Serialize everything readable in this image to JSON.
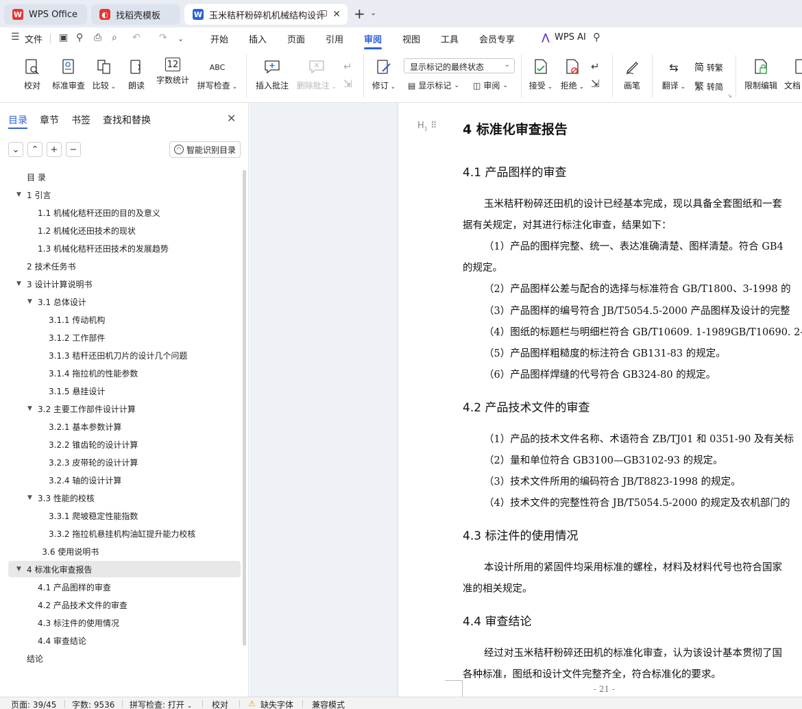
{
  "tabs": [
    {
      "label": "WPS Office",
      "icon": "wps-logo-icon",
      "color": "#e8362f"
    },
    {
      "label": "找稻壳模板",
      "icon": "docer-logo-icon",
      "color": "#e8362f"
    },
    {
      "label": "玉米秸秆粉碎机机械结构设计",
      "icon": "writer-doc-icon",
      "color": "#2b62d9"
    }
  ],
  "menu": {
    "file": "文件",
    "items": [
      "开始",
      "插入",
      "页面",
      "引用",
      "审阅",
      "视图",
      "工具",
      "会员专享"
    ],
    "active": "审阅",
    "wps_ai": "WPS AI"
  },
  "ribbon": {
    "proofread": "校对",
    "standard_review": "标准审查",
    "compare": "比较",
    "read_aloud": "朗读",
    "word_count": "字数统计",
    "spell_check": "拼写检查",
    "insert_comment": "插入批注",
    "delete_comment": "删除批注",
    "revise": "修订",
    "markup_select": "显示标记的最终状态",
    "show_markup": "显示标记",
    "review": "审阅",
    "accept": "接受",
    "reject": "拒绝",
    "pen": "画笔",
    "translate": "翻译",
    "to_traditional": "转繁",
    "to_simplified": "转简",
    "restrict_edit": "限制编辑",
    "doc_partial": "文档"
  },
  "nav": {
    "tabs": [
      "目录",
      "章节",
      "书签",
      "查找和替换"
    ],
    "active_tab": "目录",
    "smart_toc": "智能识别目录",
    "toc": [
      {
        "text": "目  录",
        "level": 0,
        "caret": false
      },
      {
        "text": "1 引言",
        "level": 0,
        "caret": true
      },
      {
        "text": "1.1 机械化秸秆还田的目的及意义",
        "level": 1,
        "caret": false
      },
      {
        "text": "1.2 机械化还田技术的现状",
        "level": 1,
        "caret": false
      },
      {
        "text": "1.3 机械化秸秆还田技术的发展趋势",
        "level": 1,
        "caret": false
      },
      {
        "text": "2 技术任务书",
        "level": 0,
        "caret": false
      },
      {
        "text": "3 设计计算说明书",
        "level": 0,
        "caret": true
      },
      {
        "text": "3.1 总体设计",
        "level": 1,
        "caret": true
      },
      {
        "text": "3.1.1 传动机构",
        "level": 2,
        "caret": false
      },
      {
        "text": "3.1.2 工作部件",
        "level": 2,
        "caret": false
      },
      {
        "text": "3.1.3 秸秆还田机刀片的设计几个问题",
        "level": 2,
        "caret": false
      },
      {
        "text": "3.1.4 拖拉机的性能参数",
        "level": 2,
        "caret": false
      },
      {
        "text": "3.1.5 悬挂设计",
        "level": 2,
        "caret": false
      },
      {
        "text": "3.2 主要工作部件设计计算",
        "level": 1,
        "caret": true
      },
      {
        "text": "3.2.1 基本参数计算",
        "level": 2,
        "caret": false
      },
      {
        "text": "3.2.2 锥齿轮的设计计算",
        "level": 2,
        "caret": false
      },
      {
        "text": "3.2.3 皮带轮的设计计算",
        "level": 2,
        "caret": false
      },
      {
        "text": "3.2.4 轴的设计计算",
        "level": 2,
        "caret": false
      },
      {
        "text": "3.3 性能的校核",
        "level": 1,
        "caret": true
      },
      {
        "text": "3.3.1 爬坡稳定性能指数",
        "level": 2,
        "caret": false
      },
      {
        "text": "3.3.2 拖拉机悬挂机构油缸提升能力校核",
        "level": 2,
        "caret": false
      },
      {
        "text": "3.6 使用说明书",
        "level": 1.4,
        "caret": false
      },
      {
        "text": "4 标准化审查报告",
        "level": 0,
        "caret": true,
        "selected": true
      },
      {
        "text": "4.1 产品图样的审查",
        "level": 1,
        "caret": false
      },
      {
        "text": "4.2 产品技术文件的审查",
        "level": 1,
        "caret": false
      },
      {
        "text": "4.3 标注件的使用情况",
        "level": 1,
        "caret": false
      },
      {
        "text": "4.4 审查结论",
        "level": 1,
        "caret": false
      },
      {
        "text": "结论",
        "level": 0,
        "caret": false
      }
    ]
  },
  "document": {
    "h1": "4   标准化审查报告",
    "s41": "4.1 产品图样的审查",
    "p41a": "玉米秸秆粉碎还田机的设计已经基本完成，现以具备全套图纸和一套",
    "p41b": "据有关规定，对其进行标注化审查，结果如下：",
    "p41c1": "（1）产品的图样完整、统一、表达准确清楚、图样清楚。符合 GB4",
    "p41c2": "的规定。",
    "p41d": "（2）产品图样公差与配合的选择与标准符合 GB/T1800、3-1998 的",
    "p41e": "（3）产品图样的编号符合 JB/T5054.5-2000 产品图样及设计的完整",
    "p41f": "（4）图纸的标题栏与明细栏符合 GB/T10609. 1-1989GB/T10690. 2-",
    "p41g": "（5）产品图样粗糙度的标注符合 GB131-83 的规定。",
    "p41h": "（6）产品图样焊缝的代号符合 GB324-80 的规定。",
    "s42": "4.2 产品技术文件的审查",
    "p42a": "（1）产品的技术文件名称、术语符合 ZB/TJ01 和 0351-90 及有关标",
    "p42b": "（2）量和单位符合 GB3100—GB3102-93 的规定。",
    "p42c": "（3）技术文件所用的编码符合 JB/T8823-1998 的规定。",
    "p42d": "（4）技术文件的完整性符合 JB/T5054.5-2000 的规定及农机部门的",
    "s43": "4.3 标注件的使用情况",
    "p43a": "本设计所用的紧固件均采用标准的螺栓，材料及材料代号也符合国家",
    "p43b": "准的相关规定。",
    "s44": "4.4 审查结论",
    "p44a": "经过对玉米秸秆粉碎还田机的标准化审查，认为该设计基本贯彻了国",
    "p44b": "各种标准，图纸和设计文件完整齐全，符合标准化的要求。",
    "page_number": "- 21 -"
  },
  "status": {
    "page": "页面: 39/45",
    "words": "字数: 9536",
    "spell": "拼写检查: 打开",
    "proof": "校对",
    "missing_font": "缺失字体",
    "compat": "兼容模式"
  }
}
